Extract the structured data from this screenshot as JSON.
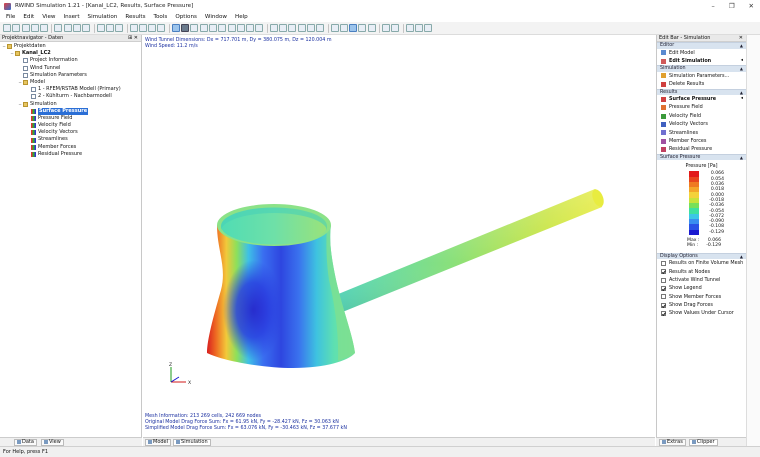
{
  "window": {
    "title": "RWIND Simulation 1.21 - [Kanal_LC2, Results, Surface Pressure]",
    "controls": [
      "–",
      "❐",
      "✕"
    ]
  },
  "menu": [
    "File",
    "Edit",
    "View",
    "Insert",
    "Simulation",
    "Results",
    "Tools",
    "Options",
    "Window",
    "Help"
  ],
  "navigator": {
    "header": "Projektnavigator - Daten",
    "items": [
      {
        "label": "Projektdaten",
        "icon": "folder-icon",
        "level": 0,
        "exp": "−"
      },
      {
        "label": "Kanal_LC2",
        "icon": "folder-icon",
        "level": 1,
        "exp": "−",
        "bold": true
      },
      {
        "label": "Project Information",
        "icon": "doc-icon",
        "level": 2
      },
      {
        "label": "Wind Tunnel",
        "icon": "doc-icon",
        "level": 2
      },
      {
        "label": "Simulation Parameters",
        "icon": "doc-icon",
        "level": 2
      },
      {
        "label": "Model",
        "icon": "folder-icon",
        "level": 2,
        "exp": "−"
      },
      {
        "label": "1 - RFEM/RSTAB Modell (Primary)",
        "icon": "doc-icon",
        "level": 3
      },
      {
        "label": "2 - Kühlturm - Nachbarmodell",
        "icon": "doc-icon",
        "level": 3
      },
      {
        "label": "Simulation",
        "icon": "folder-icon",
        "level": 2,
        "exp": "−"
      },
      {
        "label": "Surface Pressure",
        "icon": "grid-icon",
        "level": 3,
        "selected": true
      },
      {
        "label": "Pressure Field",
        "icon": "grid-icon",
        "level": 3
      },
      {
        "label": "Velocity Field",
        "icon": "grid-icon",
        "level": 3
      },
      {
        "label": "Velocity Vectors",
        "icon": "grid-icon",
        "level": 3
      },
      {
        "label": "Streamlines",
        "icon": "grid-icon",
        "level": 3
      },
      {
        "label": "Member Forces",
        "icon": "grid-icon",
        "level": 3
      },
      {
        "label": "Residual Pressure",
        "icon": "grid-icon",
        "level": 3
      }
    ],
    "tabs": [
      "Data",
      "View"
    ]
  },
  "view": {
    "info_top": [
      "Wind Tunnel Dimensions: Dx = 717.701 m, Dy = 380.075 m, Dz = 120.004 m",
      "Wind Speed: 11.2 m/s"
    ],
    "info_bottom": [
      "Mesh Information: 213 269 cells, 242 669 nodes",
      "Original Model Drag Force Sum: Fx = 61.95 kN, Fy = -28.427 kN, Fz = 30.063 kN",
      "Simplified Model Drag Force Sum: Fx = 63.076 kN, Fy = -30.463 kN, Fz = 37.677 kN"
    ],
    "axes": {
      "z": "Z",
      "x": "X"
    },
    "tabs": [
      "Model",
      "Simulation"
    ]
  },
  "editbar": {
    "header": "Edit Bar - Simulation",
    "sections": {
      "editor": "Editor",
      "simulation": "Simulation",
      "results": "Results",
      "surface_pressure": "Surface Pressure",
      "display_options": "Display Options"
    },
    "editor_items": [
      "Edit Model",
      "Edit Simulation"
    ],
    "simulation_items": [
      "Simulation Parameters...",
      "Delete Results"
    ],
    "results_items": [
      "Surface Pressure",
      "Pressure Field",
      "Velocity Field",
      "Velocity Vectors",
      "Streamlines",
      "Member Forces",
      "Residual Pressure"
    ],
    "legend": {
      "title": "Pressure [Pa]",
      "values": [
        "0.066",
        "0.054",
        "0.036",
        "0.018",
        "0.000",
        "-0.018",
        "-0.036",
        "-0.054",
        "-0.072",
        "-0.090",
        "-0.108",
        "-0.129"
      ],
      "colors": [
        "#e21a1a",
        "#e8461e",
        "#ef7a22",
        "#f4a62a",
        "#f4d23a",
        "#c8e23c",
        "#78e05a",
        "#3ee0a0",
        "#3cc6e6",
        "#3a8ef0",
        "#2a52e6",
        "#1a1ad0"
      ],
      "max_label": "Max :",
      "max": "0.066",
      "min_label": "Min :",
      "min": "-0.129"
    },
    "display_options": [
      {
        "label": "Results on Finite Volume Mesh",
        "checked": false
      },
      {
        "label": "Results at Nodes",
        "checked": true
      },
      {
        "label": "Activate Wind Tunnel",
        "checked": false
      },
      {
        "label": "Show Legend",
        "checked": true
      },
      {
        "label": "Show Member Forces",
        "checked": false
      },
      {
        "label": "Show Drag Forces",
        "checked": true
      },
      {
        "label": "Show Values Under Cursor",
        "checked": true
      }
    ],
    "tabs": [
      "Extras",
      "Clipper"
    ]
  },
  "status": "For Help, press F1"
}
